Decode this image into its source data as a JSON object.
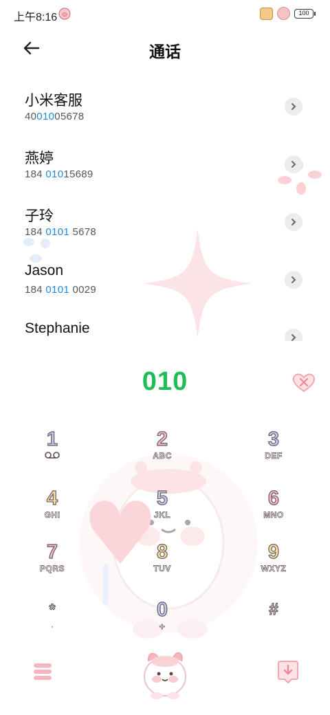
{
  "status_bar": {
    "time": "上午8:16",
    "battery": "100"
  },
  "header": {
    "title": "通话"
  },
  "contacts": [
    {
      "name": "小米客服",
      "number_pre": "40",
      "number_match": "010",
      "number_post": "05678"
    },
    {
      "name": "燕婷",
      "number_pre": "184 ",
      "number_match": "010",
      "number_post": "15689"
    },
    {
      "name": "子玲",
      "number_pre": "184 ",
      "number_match": "0101",
      "number_post": " 5678"
    },
    {
      "name": "Jason",
      "number_pre": "184 ",
      "number_match": "0101",
      "number_post": " 0029"
    },
    {
      "name": "Stephanie",
      "number_pre": "",
      "number_match": "",
      "number_post": ""
    }
  ],
  "dialer": {
    "number": "010"
  },
  "keypad": {
    "keys": [
      {
        "digit": "1",
        "letters": ""
      },
      {
        "digit": "2",
        "letters": "ABC"
      },
      {
        "digit": "3",
        "letters": "DEF"
      },
      {
        "digit": "4",
        "letters": "GHI"
      },
      {
        "digit": "5",
        "letters": "JKL"
      },
      {
        "digit": "6",
        "letters": "MNO"
      },
      {
        "digit": "7",
        "letters": "PQRS"
      },
      {
        "digit": "8",
        "letters": "TUV"
      },
      {
        "digit": "9",
        "letters": "WXYZ"
      },
      {
        "digit": "*",
        "letters": ""
      },
      {
        "digit": "0",
        "letters": "+"
      },
      {
        "digit": "#",
        "letters": ""
      }
    ]
  },
  "colors": {
    "dial_number": "#1fbd56",
    "match_highlight": "#1e8ad6",
    "accent_pink": "#f3b9c0"
  },
  "icons": {
    "back": "back-arrow-icon",
    "chevron": "chevron-right-icon",
    "delete": "heart-delete-icon",
    "voicemail": "voicemail-icon",
    "menu": "menu-icon",
    "call": "sheep-call-icon",
    "download": "download-icon"
  }
}
